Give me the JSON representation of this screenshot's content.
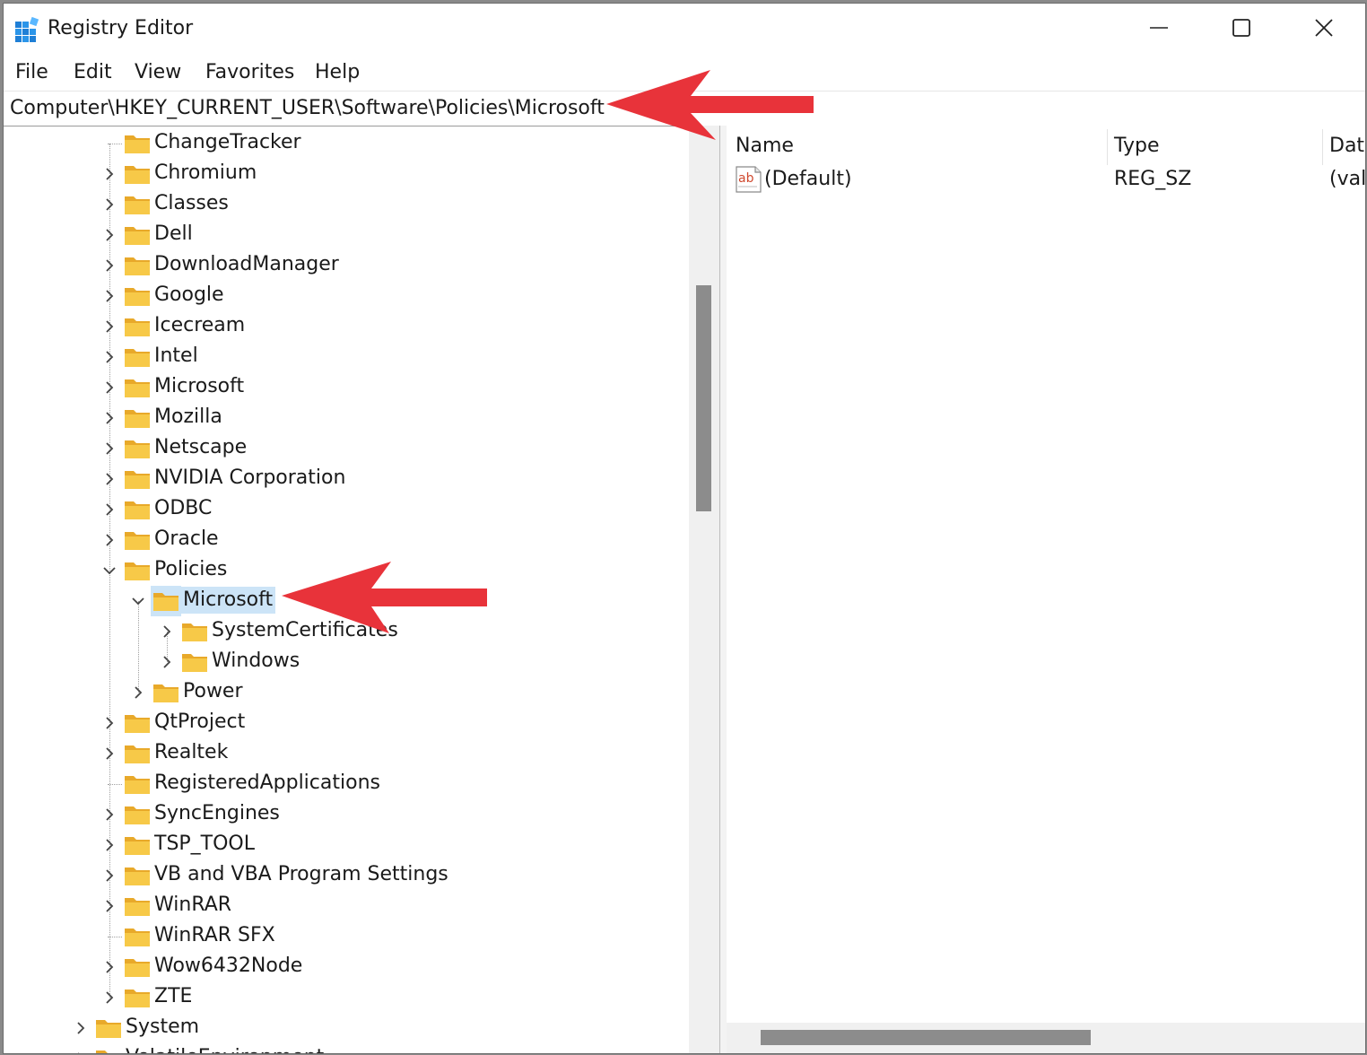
{
  "window": {
    "title": "Registry Editor"
  },
  "window_controls": {
    "minimize": "minimize-icon",
    "maximize": "maximize-icon",
    "close": "close-icon"
  },
  "menu": [
    "File",
    "Edit",
    "View",
    "Favorites",
    "Help"
  ],
  "address_bar": {
    "path": "Computer\\HKEY_CURRENT_USER\\Software\\Policies\\Microsoft"
  },
  "tree": {
    "items": [
      {
        "label": "ChangeTracker",
        "level": 1,
        "expander": "none"
      },
      {
        "label": "Chromium",
        "level": 1,
        "expander": "collapsed"
      },
      {
        "label": "Classes",
        "level": 1,
        "expander": "collapsed"
      },
      {
        "label": "Dell",
        "level": 1,
        "expander": "collapsed"
      },
      {
        "label": "DownloadManager",
        "level": 1,
        "expander": "collapsed"
      },
      {
        "label": "Google",
        "level": 1,
        "expander": "collapsed"
      },
      {
        "label": "Icecream",
        "level": 1,
        "expander": "collapsed"
      },
      {
        "label": "Intel",
        "level": 1,
        "expander": "collapsed"
      },
      {
        "label": "Microsoft",
        "level": 1,
        "expander": "collapsed"
      },
      {
        "label": "Mozilla",
        "level": 1,
        "expander": "collapsed"
      },
      {
        "label": "Netscape",
        "level": 1,
        "expander": "collapsed"
      },
      {
        "label": "NVIDIA Corporation",
        "level": 1,
        "expander": "collapsed"
      },
      {
        "label": "ODBC",
        "level": 1,
        "expander": "collapsed"
      },
      {
        "label": "Oracle",
        "level": 1,
        "expander": "collapsed"
      },
      {
        "label": "Policies",
        "level": 1,
        "expander": "expanded"
      },
      {
        "label": "Microsoft",
        "level": 2,
        "expander": "expanded",
        "selected": true
      },
      {
        "label": "SystemCertificates",
        "level": 3,
        "expander": "collapsed"
      },
      {
        "label": "Windows",
        "level": 3,
        "expander": "collapsed"
      },
      {
        "label": "Power",
        "level": 2,
        "expander": "collapsed"
      },
      {
        "label": "QtProject",
        "level": 1,
        "expander": "collapsed"
      },
      {
        "label": "Realtek",
        "level": 1,
        "expander": "collapsed"
      },
      {
        "label": "RegisteredApplications",
        "level": 1,
        "expander": "none"
      },
      {
        "label": "SyncEngines",
        "level": 1,
        "expander": "collapsed"
      },
      {
        "label": "TSP_TOOL",
        "level": 1,
        "expander": "collapsed"
      },
      {
        "label": "VB and VBA Program Settings",
        "level": 1,
        "expander": "collapsed"
      },
      {
        "label": "WinRAR",
        "level": 1,
        "expander": "collapsed"
      },
      {
        "label": "WinRAR SFX",
        "level": 1,
        "expander": "none"
      },
      {
        "label": "Wow6432Node",
        "level": 1,
        "expander": "collapsed"
      },
      {
        "label": "ZTE",
        "level": 1,
        "expander": "collapsed"
      },
      {
        "label": "System",
        "level": 0,
        "expander": "collapsed"
      },
      {
        "label": "VolatileEnvironment",
        "level": 0,
        "expander": "collapsed"
      }
    ]
  },
  "values": {
    "columns": {
      "name": "Name",
      "type": "Type",
      "data": "Data"
    },
    "rows": [
      {
        "name": "(Default)",
        "type": "REG_SZ",
        "data": "(value not set)",
        "icon": "string-value-icon"
      }
    ]
  },
  "colors": {
    "selection": "#cce4f7",
    "folder": "#f7c948",
    "folder_dark": "#e8a92a",
    "arrow": "#e8333a",
    "scroll_thumb": "#8c8c8c"
  },
  "annotations": {
    "arrow_icon": "red-arrow-icon",
    "count": 2
  }
}
